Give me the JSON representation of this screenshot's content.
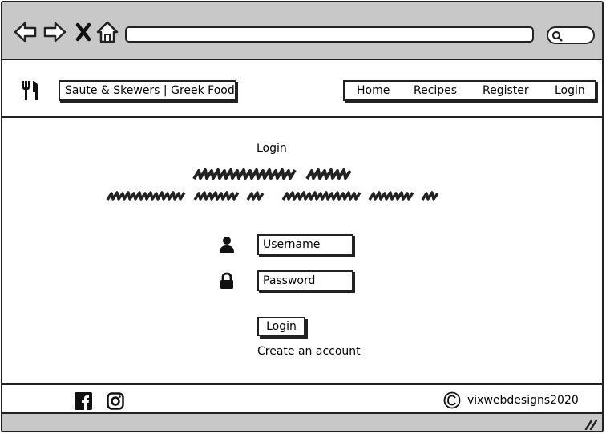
{
  "header": {
    "site_title": "Saute & Skewers | Greek Food",
    "nav": [
      "Home",
      "Recipes",
      "Register",
      "Login"
    ]
  },
  "main": {
    "heading": "Login",
    "username_placeholder": "Username",
    "password_placeholder": "Password",
    "login_button": "Login",
    "create_account": "Create an account"
  },
  "footer": {
    "copyright": "vixwebdesigns2020"
  },
  "icons": {
    "back": "arrow-left-icon",
    "forward": "arrow-right-icon",
    "stop": "close-icon",
    "home": "home-icon",
    "search": "search-icon",
    "logo": "cutlery-icon",
    "user": "user-icon",
    "lock": "lock-icon",
    "facebook": "facebook-icon",
    "instagram": "instagram-icon",
    "copyright": "copyright-icon"
  }
}
